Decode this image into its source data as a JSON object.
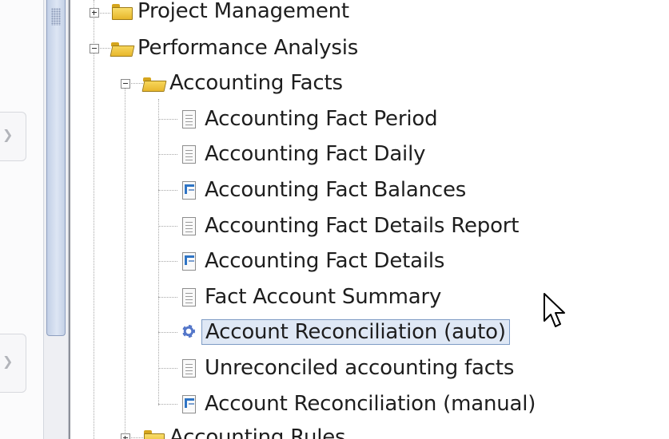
{
  "tree": {
    "project_management": {
      "label": "Project Management"
    },
    "performance_analysis": {
      "label": "Performance Analysis"
    },
    "accounting_facts": {
      "label": "Accounting Facts",
      "items": [
        {
          "label": "Accounting Fact Period",
          "icon": "report-icon"
        },
        {
          "label": "Accounting Fact Daily",
          "icon": "report-icon"
        },
        {
          "label": "Accounting Fact Balances",
          "icon": "window-icon"
        },
        {
          "label": "Accounting Fact Details Report",
          "icon": "report-icon"
        },
        {
          "label": "Accounting Fact Details",
          "icon": "window-icon"
        },
        {
          "label": "Fact Account Summary",
          "icon": "report-icon"
        },
        {
          "label": "Account Reconciliation (auto)",
          "icon": "process-gear-icon"
        },
        {
          "label": "Unreconciled accounting facts",
          "icon": "report-icon"
        },
        {
          "label": "Account Reconciliation (manual)",
          "icon": "window-icon"
        }
      ]
    },
    "accounting_rules": {
      "label": "Accounting Rules"
    }
  },
  "colors": {
    "selection_bg": "#dfe8f5",
    "selection_border": "#7d9bc4",
    "folder": "#f0c845",
    "window_icon": "#2f74c4"
  }
}
